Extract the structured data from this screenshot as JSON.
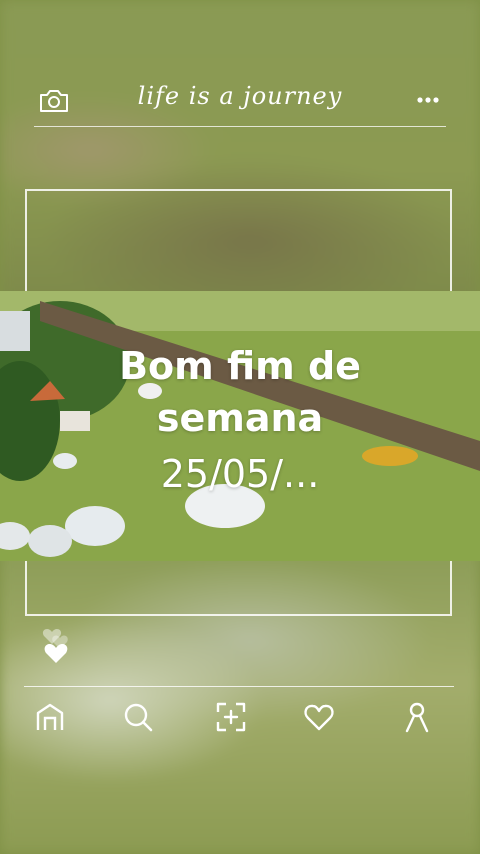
{
  "header": {
    "title": "life is a journey",
    "left_icon": "camera-icon",
    "right_icon": "more-icon"
  },
  "caption": {
    "line1": "Bom fim de",
    "line2": "semana",
    "line3": "25/05/..."
  },
  "bottom_nav": {
    "items": [
      "home-icon",
      "search-icon",
      "scan-add-icon",
      "heart-icon",
      "profile-icon"
    ]
  },
  "colors": {
    "foreground": "#ffffff",
    "background_green": "#8a9a54"
  }
}
